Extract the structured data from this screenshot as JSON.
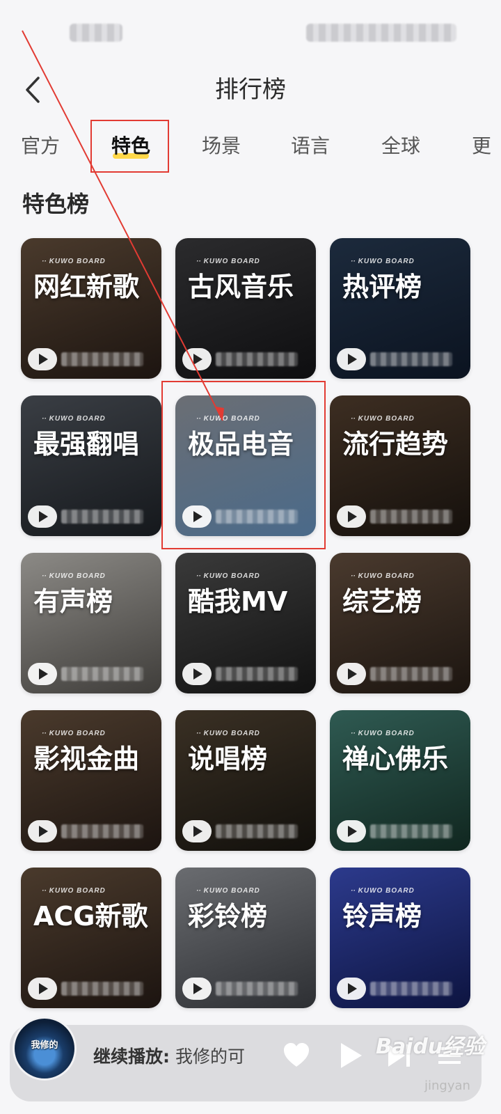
{
  "header": {
    "title": "排行榜"
  },
  "tabs": [
    {
      "label": "官方",
      "active": false
    },
    {
      "label": "特色",
      "active": true
    },
    {
      "label": "场景",
      "active": false
    },
    {
      "label": "语言",
      "active": false
    },
    {
      "label": "全球",
      "active": false
    },
    {
      "label": "更",
      "active": false
    }
  ],
  "section": {
    "title": "特色榜"
  },
  "brand_label": "KUWO BOARD",
  "charts": [
    {
      "name": "网红新歌",
      "colors": [
        "#4a3a2c",
        "#1c1410"
      ]
    },
    {
      "name": "古风音乐",
      "colors": [
        "#2b2b2d",
        "#0e0e10"
      ]
    },
    {
      "name": "热评榜",
      "colors": [
        "#1c2a3c",
        "#0b1320"
      ]
    },
    {
      "name": "最强翻唱",
      "colors": [
        "#3a3e44",
        "#15181c"
      ]
    },
    {
      "name": "极品电音",
      "colors": [
        "#6b6e74",
        "#4a6a8a"
      ]
    },
    {
      "name": "流行趋势",
      "colors": [
        "#3d2e22",
        "#15100c"
      ]
    },
    {
      "name": "有声榜",
      "colors": [
        "#8c8a86",
        "#3f3d3a"
      ]
    },
    {
      "name": "酷我MV",
      "colors": [
        "#3a3a3a",
        "#121212"
      ]
    },
    {
      "name": "综艺榜",
      "colors": [
        "#4a3a2e",
        "#1c1510"
      ]
    },
    {
      "name": "影视金曲",
      "colors": [
        "#4a3a2c",
        "#1c1410"
      ]
    },
    {
      "name": "说唱榜",
      "colors": [
        "#3a3024",
        "#12100c"
      ]
    },
    {
      "name": "禅心佛乐",
      "colors": [
        "#2f5a52",
        "#10261f"
      ]
    },
    {
      "name": "ACG新歌",
      "colors": [
        "#4a3a2c",
        "#1c1410"
      ]
    },
    {
      "name": "彩铃榜",
      "colors": [
        "#6a6c70",
        "#2d2f33"
      ]
    },
    {
      "name": "铃声榜",
      "colors": [
        "#2c3a8c",
        "#0d1440"
      ]
    }
  ],
  "player": {
    "prefix": "继续播放:",
    "track": "我修的可",
    "cover_text": "我修的"
  },
  "watermark": {
    "brand": "Baidu经验",
    "sub": "jingyan"
  },
  "colors": {
    "accent": "#ffd84a",
    "annotation": "#e23b33"
  }
}
